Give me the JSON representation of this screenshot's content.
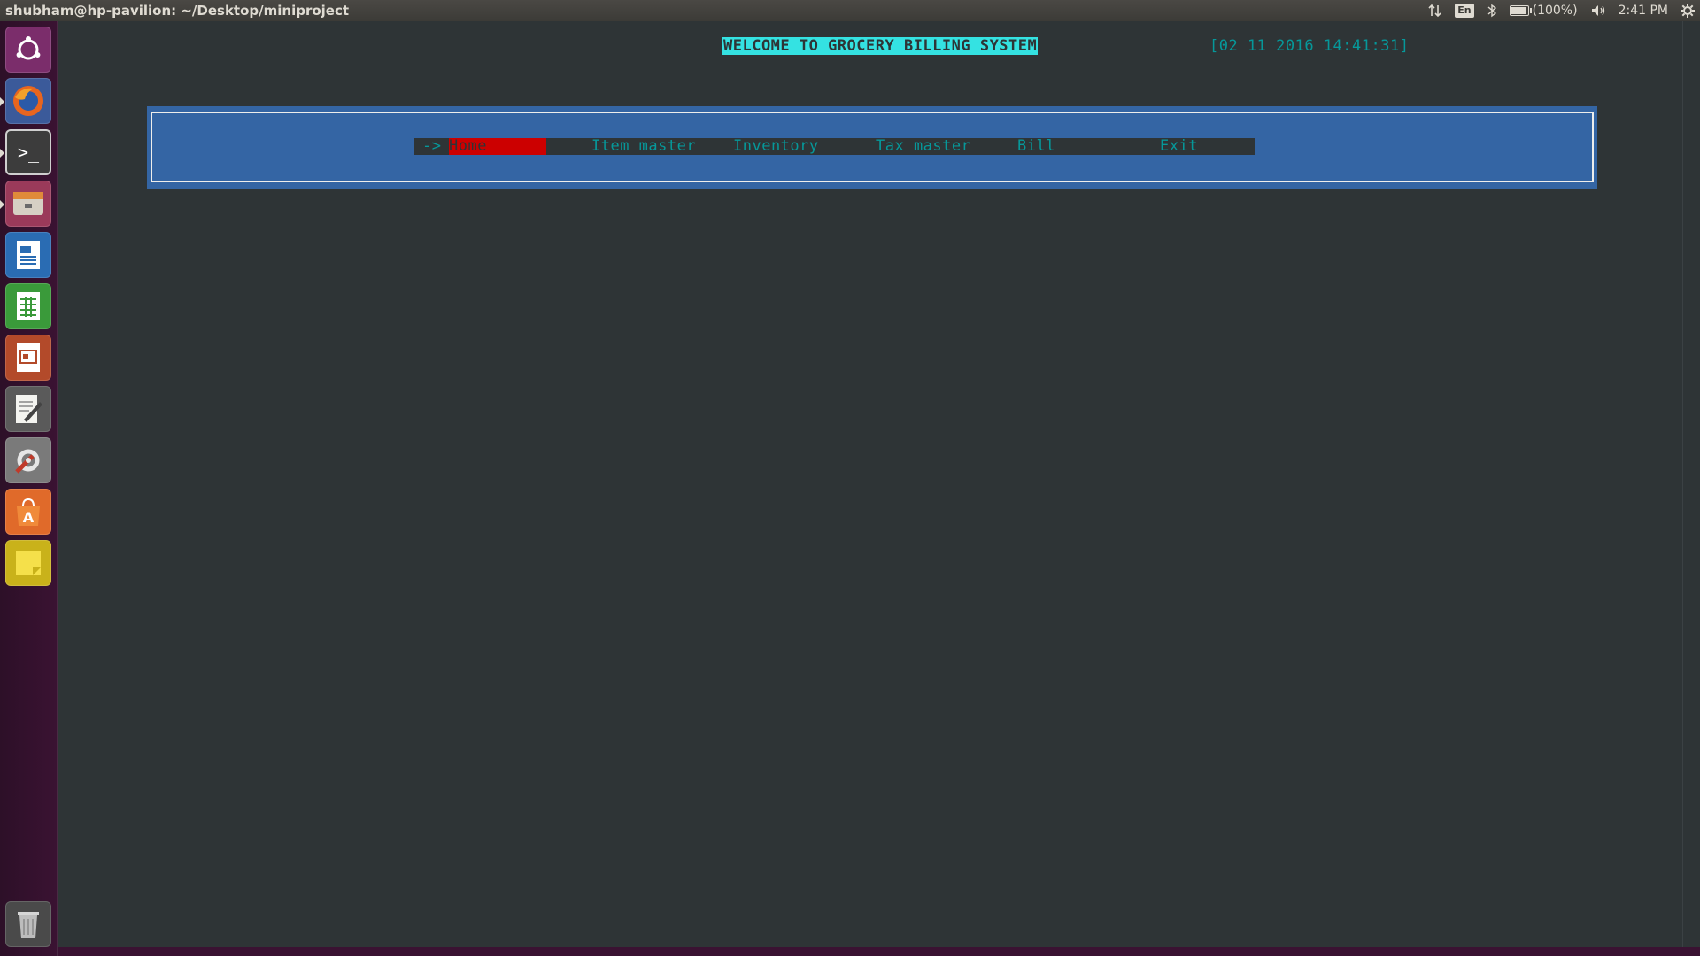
{
  "top_panel": {
    "window_title": "shubham@hp-pavilion: ~/Desktop/miniproject",
    "indicators": {
      "network_icon": "network-updown-icon",
      "keyboard_layout": "En",
      "bluetooth_icon": "bluetooth-icon",
      "battery_level": 1.0,
      "battery_text": "(100%)",
      "volume_icon": "volume-icon",
      "time": "2:41 PM",
      "system_icon": "gear-icon"
    }
  },
  "launcher": {
    "items": [
      {
        "name": "ubuntu-dash-icon",
        "color": "#7b2d6b"
      },
      {
        "name": "firefox-icon",
        "color": "#d9531e"
      },
      {
        "name": "terminal-icon",
        "color": "#4d4d4d"
      },
      {
        "name": "files-icon",
        "color": "#9a3a5a"
      },
      {
        "name": "libreoffice-writer-icon",
        "color": "#2a6cb3"
      },
      {
        "name": "libreoffice-calc-icon",
        "color": "#3a9a3a"
      },
      {
        "name": "libreoffice-impress-icon",
        "color": "#b34a2a"
      },
      {
        "name": "text-editor-icon",
        "color": "#6a6a6a"
      },
      {
        "name": "system-settings-icon",
        "color": "#8a8a8a"
      },
      {
        "name": "software-center-icon",
        "color": "#e06a2a"
      },
      {
        "name": "sticky-notes-icon",
        "color": "#d9c21e"
      },
      {
        "name": "trash-icon",
        "color": "#6a6a6a"
      }
    ]
  },
  "terminal": {
    "welcome_text": "WELCOME TO GROCERY BILLING SYSTEM",
    "datetime_text": "[02 11 2016 14:41:31]",
    "menu": {
      "arrow": "->",
      "items": [
        "Home",
        "Item master",
        "Inventory",
        "Tax master",
        "Bill",
        "Exit"
      ],
      "selected_index": 0
    }
  },
  "colors": {
    "terminal_bg": "#2e3436",
    "welcome_bg": "#34e2e2",
    "cyan_text": "#06989a",
    "menu_panel_bg": "#3465a4",
    "selected_bg": "#cc0000"
  }
}
